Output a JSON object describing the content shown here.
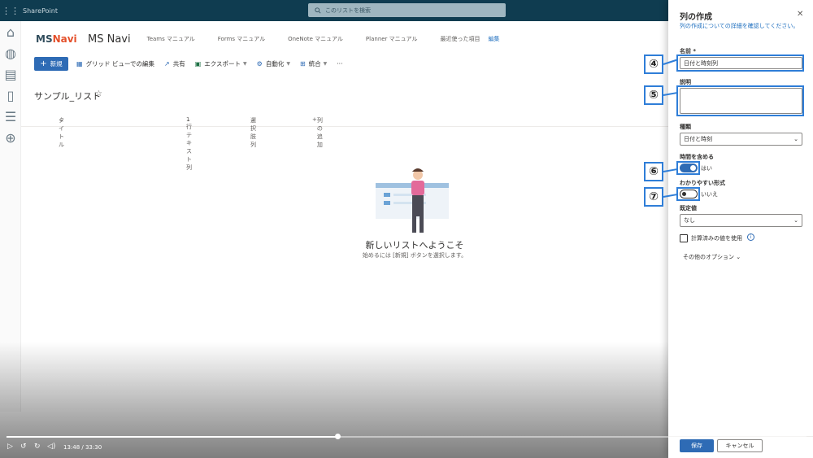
{
  "suitebar": {
    "brand": "SharePoint",
    "search_placeholder": "このリストを検索"
  },
  "site": {
    "logo_text_left": "MS",
    "logo_text_right": "Navi",
    "name": "MS Navi",
    "nav": [
      "Teams マニュアル",
      "Forms マニュアル",
      "OneNote マニュアル",
      "Planner マニュアル",
      "最近使った項目"
    ],
    "edit_link": "編集"
  },
  "commandbar": {
    "new_label": "新規",
    "grid_edit": "グリッド ビューでの編集",
    "share": "共有",
    "export": "エクスポート",
    "automate": "自動化",
    "integrate": "統合",
    "more": "···"
  },
  "list": {
    "title": "サンプル_リスト",
    "columns": [
      "タイトル",
      "1行テキスト列",
      "選択肢列"
    ],
    "add_column": "列の追加",
    "empty_title": "新しいリストへようこそ",
    "empty_subtitle": "始めるには [新規] ボタンを選択します。"
  },
  "panel": {
    "title": "列の作成",
    "details_link": "列の作成についての詳細を確認してください。",
    "name_label": "名前 *",
    "name_value": "日付と時刻列",
    "description_label": "説明",
    "description_value": "",
    "type_label": "種類",
    "type_value": "日付と時刻",
    "include_time_label": "時間を含める",
    "include_time_state": "はい",
    "friendly_label": "わかりやすい形式",
    "friendly_state": "いいえ",
    "default_label": "既定値",
    "default_value": "なし",
    "calculated_label": "計算済みの値を使用",
    "more_options": "その他のオプション",
    "save": "保存",
    "cancel": "キャンセル"
  },
  "callouts": [
    "④",
    "⑤",
    "⑥",
    "⑦"
  ],
  "video": {
    "time": "13:48 / 33:30",
    "progress": 0.414
  },
  "colors": {
    "suitebar": "#0f3c50",
    "accent": "#2e6bb5",
    "callout": "#2f7ed8"
  }
}
